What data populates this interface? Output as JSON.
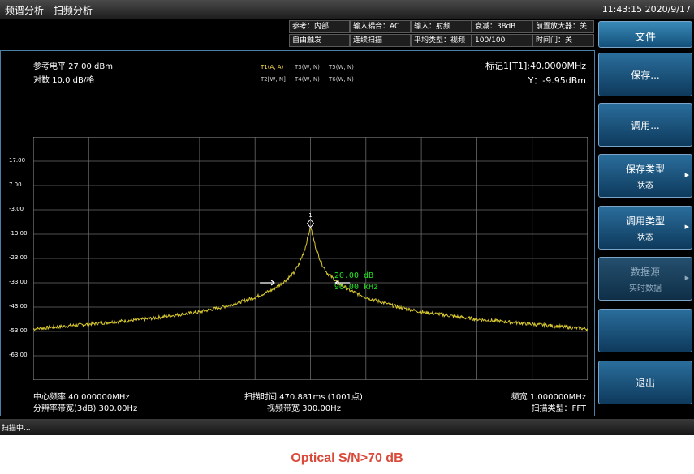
{
  "window": {
    "title": "频谱分析 - 扫频分析",
    "clock": "11:43:15  2020/9/17"
  },
  "info": {
    "row1": [
      "参考：内部",
      "输入耦合：AC",
      "输入：射频",
      "衰减：38dB",
      "前置放大器：关"
    ],
    "row2": [
      "自由触发",
      "连续扫描",
      "平均类型：视频",
      "100/100",
      "时间门：关"
    ]
  },
  "display": {
    "ref_level": "参考电平 27.00 dBm",
    "scale": "对数 10.0 dB/格",
    "traces_row1": [
      "T1(A, A)",
      "T3(W, N)",
      "T5(W, N)"
    ],
    "traces_row2": [
      "T2[W, N]",
      "T4(W, N)",
      "T6(W, N)"
    ],
    "marker_title": "标记1[T1]:40.0000MHz",
    "marker_y": "Y：-9.95dBm",
    "center": "中心频率 40.000000MHz",
    "rbw": "分辨率带宽(3dB) 300.00Hz",
    "sweep_time": "扫描时间 470.881ms (1001点)",
    "vbw": "视频带宽 300.00Hz",
    "span": "频宽 1.000000MHz",
    "sweep_type": "扫描类型：FFT"
  },
  "chart_data": {
    "type": "line",
    "y_ticks": [
      "17.00",
      "7.00",
      "-3.00",
      "-13.00",
      "-23.00",
      "-33.00",
      "-43.00",
      "-53.00",
      "-63.00"
    ],
    "ylim": [
      -73,
      27
    ],
    "xlim": [
      39.5,
      40.5
    ],
    "grid": true,
    "series": [
      {
        "color": "#d8c830",
        "x": [
          39.5,
          39.6,
          39.7,
          39.8,
          39.85,
          39.9,
          39.93,
          39.95,
          39.97,
          39.98,
          39.99,
          40.0,
          40.01,
          40.02,
          40.03,
          40.05,
          40.07,
          40.1,
          40.15,
          40.2,
          40.3,
          40.4,
          40.5
        ],
        "y": [
          -52,
          -50,
          -48,
          -45,
          -42.5,
          -39,
          -36,
          -33,
          -29,
          -25,
          -19,
          -9.95,
          -19,
          -25,
          -29,
          -33,
          -36,
          -39,
          -42.5,
          -45,
          -48,
          -50,
          -52
        ]
      }
    ],
    "marker": {
      "label": "1",
      "x": 40.0,
      "y": -9.95
    },
    "annotations": [
      "20.00 dB",
      "90.00 kHz"
    ]
  },
  "softkeys": [
    {
      "label": "文件"
    },
    {
      "label": "保存..."
    },
    {
      "label": "调用..."
    },
    {
      "label": "保存类型",
      "sub": "状态"
    },
    {
      "label": "调用类型",
      "sub": "状态"
    },
    {
      "label": "数据源",
      "sub": "实时数据"
    },
    {
      "label": ""
    },
    {
      "label": "退出"
    }
  ],
  "status": "扫描中...",
  "caption": "Optical S/N>70 dB"
}
